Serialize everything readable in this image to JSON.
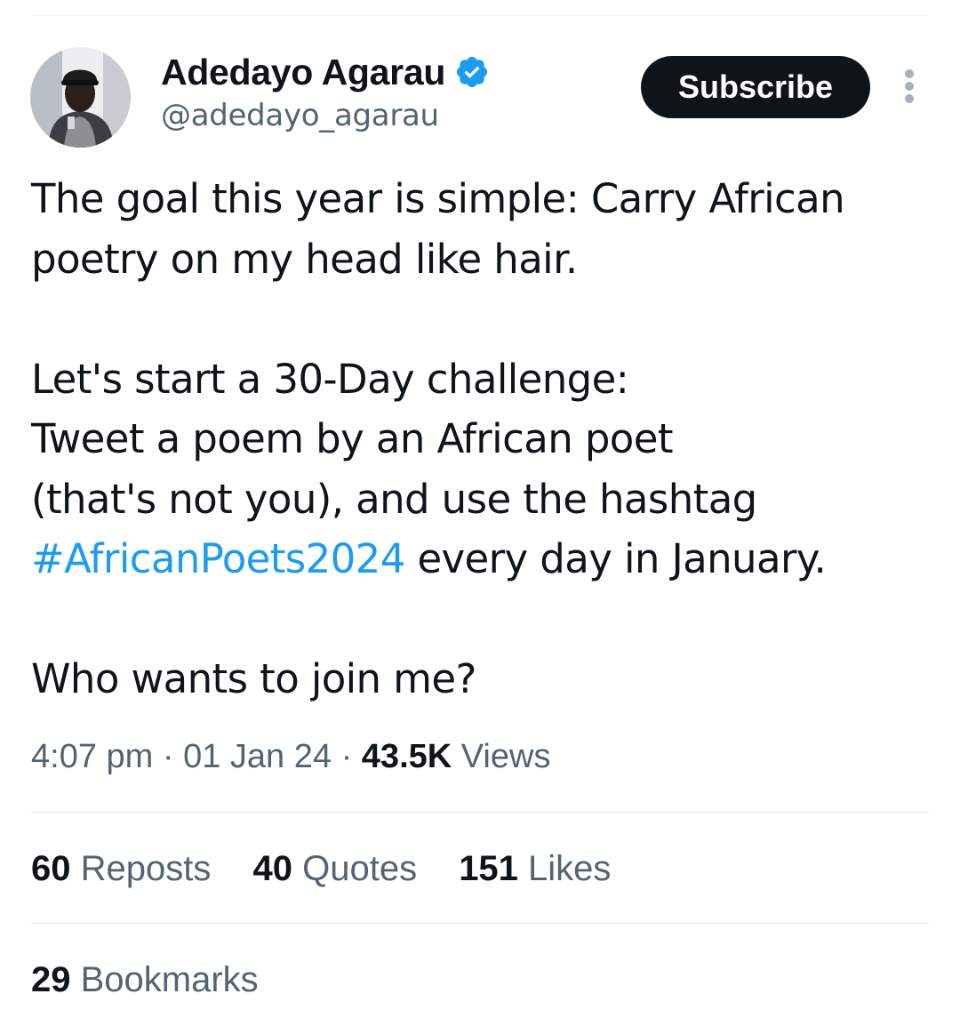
{
  "author": {
    "display_name": "Adedayo Agarau",
    "handle": "@adedayo_agarau",
    "verified_icon": "verified-badge-icon"
  },
  "subscribe_label": "Subscribe",
  "more_icon": "more-vertical-icon",
  "tweet": {
    "line1": "The goal this year is simple: Carry African",
    "line2": "poetry on my head like hair.",
    "line3": "Let's start a 30-Day challenge:",
    "line4": "Tweet a poem by an African poet",
    "line5": "(that's not you), and use the hashtag",
    "hashtag": "#AfricanPoets2024",
    "line6_rest": " every day in January.",
    "line7": "Who wants to join me?"
  },
  "meta": {
    "time": "4:07 pm",
    "sep1": " · ",
    "date": "01 Jan 24",
    "sep2": " · ",
    "views_count": "43.5K",
    "views_label": " Views"
  },
  "stats": {
    "reposts_count": "60",
    "reposts_label": " Reposts",
    "quotes_count": "40",
    "quotes_label": " Quotes",
    "likes_count": "151",
    "likes_label": " Likes",
    "bookmarks_count": "29",
    "bookmarks_label": " Bookmarks"
  },
  "colors": {
    "text": "#0f1419",
    "secondary": "#536471",
    "link": "#1d9bf0",
    "button_bg": "#0f1419",
    "verified": "#1d9bf0"
  }
}
